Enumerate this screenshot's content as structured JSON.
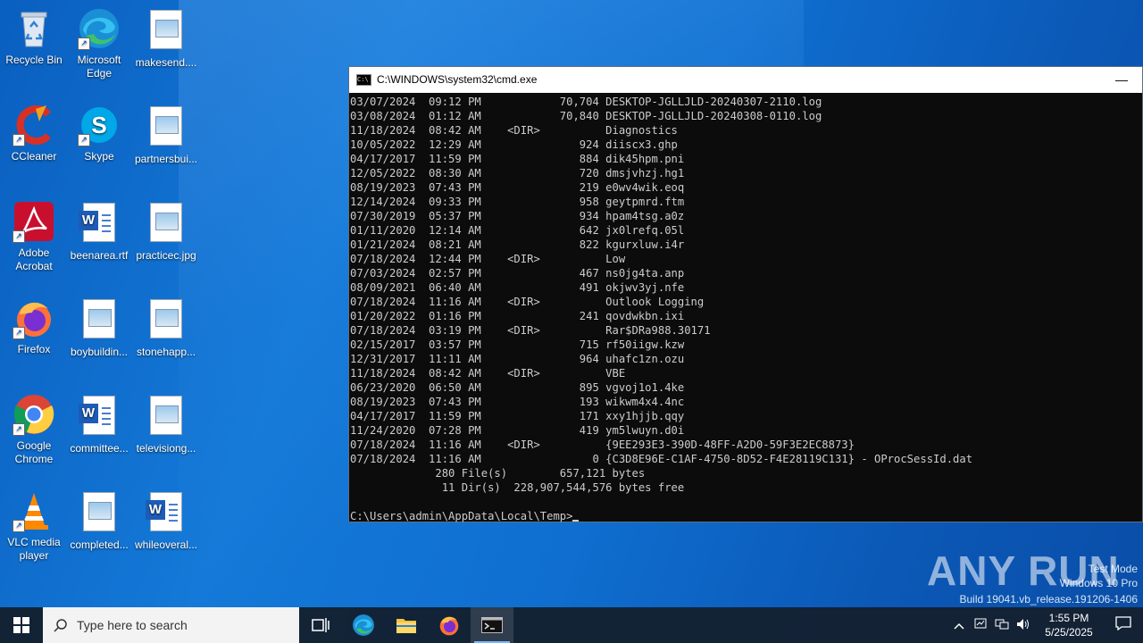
{
  "desktop": {
    "icons": [
      {
        "label": "Recycle Bin"
      },
      {
        "label": "Microsoft Edge"
      },
      {
        "label": "makesend...."
      },
      {
        "label": "CCleaner"
      },
      {
        "label": "Skype"
      },
      {
        "label": "partnersbui..."
      },
      {
        "label": "Adobe Acrobat"
      },
      {
        "label": "beenarea.rtf"
      },
      {
        "label": "practicec.jpg"
      },
      {
        "label": "Firefox"
      },
      {
        "label": "boybuildin..."
      },
      {
        "label": "stonehapp..."
      },
      {
        "label": "Google Chrome"
      },
      {
        "label": "committee..."
      },
      {
        "label": "televisiong..."
      },
      {
        "label": "VLC media player"
      },
      {
        "label": "completed..."
      },
      {
        "label": "whileoveral..."
      }
    ]
  },
  "cmd": {
    "title": "C:\\WINDOWS\\system32\\cmd.exe",
    "minimize_glyph": "—",
    "lines": [
      "03/07/2024  09:12 PM            70,704 DESKTOP-JGLLJLD-20240307-2110.log",
      "03/08/2024  01:12 AM            70,840 DESKTOP-JGLLJLD-20240308-0110.log",
      "11/18/2024  08:42 AM    <DIR>          Diagnostics",
      "10/05/2022  12:29 AM               924 diiscx3.ghp",
      "04/17/2017  11:59 PM               884 dik45hpm.pni",
      "12/05/2022  08:30 AM               720 dmsjvhzj.hg1",
      "08/19/2023  07:43 PM               219 e0wv4wik.eoq",
      "12/14/2024  09:33 PM               958 geytpmrd.ftm",
      "07/30/2019  05:37 PM               934 hpam4tsg.a0z",
      "01/11/2020  12:14 AM               642 jx0lrefq.05l",
      "01/21/2024  08:21 AM               822 kgurxluw.i4r",
      "07/18/2024  12:44 PM    <DIR>          Low",
      "07/03/2024  02:57 PM               467 ns0jg4ta.anp",
      "08/09/2021  06:40 AM               491 okjwv3yj.nfe",
      "07/18/2024  11:16 AM    <DIR>          Outlook Logging",
      "01/20/2022  01:16 PM               241 qovdwkbn.ixi",
      "07/18/2024  03:19 PM    <DIR>          Rar$DRa988.30171",
      "02/15/2017  03:57 PM               715 rf50iigw.kzw",
      "12/31/2017  11:11 AM               964 uhafc1zn.ozu",
      "11/18/2024  08:42 AM    <DIR>          VBE",
      "06/23/2020  06:50 AM               895 vgvoj1o1.4ke",
      "08/19/2023  07:43 PM               193 wikwm4x4.4nc",
      "04/17/2017  11:59 PM               171 xxy1hjjb.qqy",
      "11/24/2020  07:28 PM               419 ym5lwuyn.d0i",
      "07/18/2024  11:16 AM    <DIR>          {9EE293E3-390D-48FF-A2D0-59F3E2EC8873}",
      "07/18/2024  11:16 AM                 0 {C3D8E96E-C1AF-4750-8D52-F4E28119C131} - OProcSessId.dat",
      "             280 File(s)        657,121 bytes",
      "              11 Dir(s)  228,907,544,576 bytes free",
      "",
      "C:\\Users\\admin\\AppData\\Local\\Temp>"
    ]
  },
  "watermark": {
    "brand": "ANY RUN",
    "line1": "Test Mode",
    "line2": "Windows 10 Pro",
    "line3": "Build 19041.vb_release.191206-1406"
  },
  "taskbar": {
    "search_placeholder": "Type here to search",
    "time": "1:55 PM",
    "date": "5/25/2025"
  }
}
